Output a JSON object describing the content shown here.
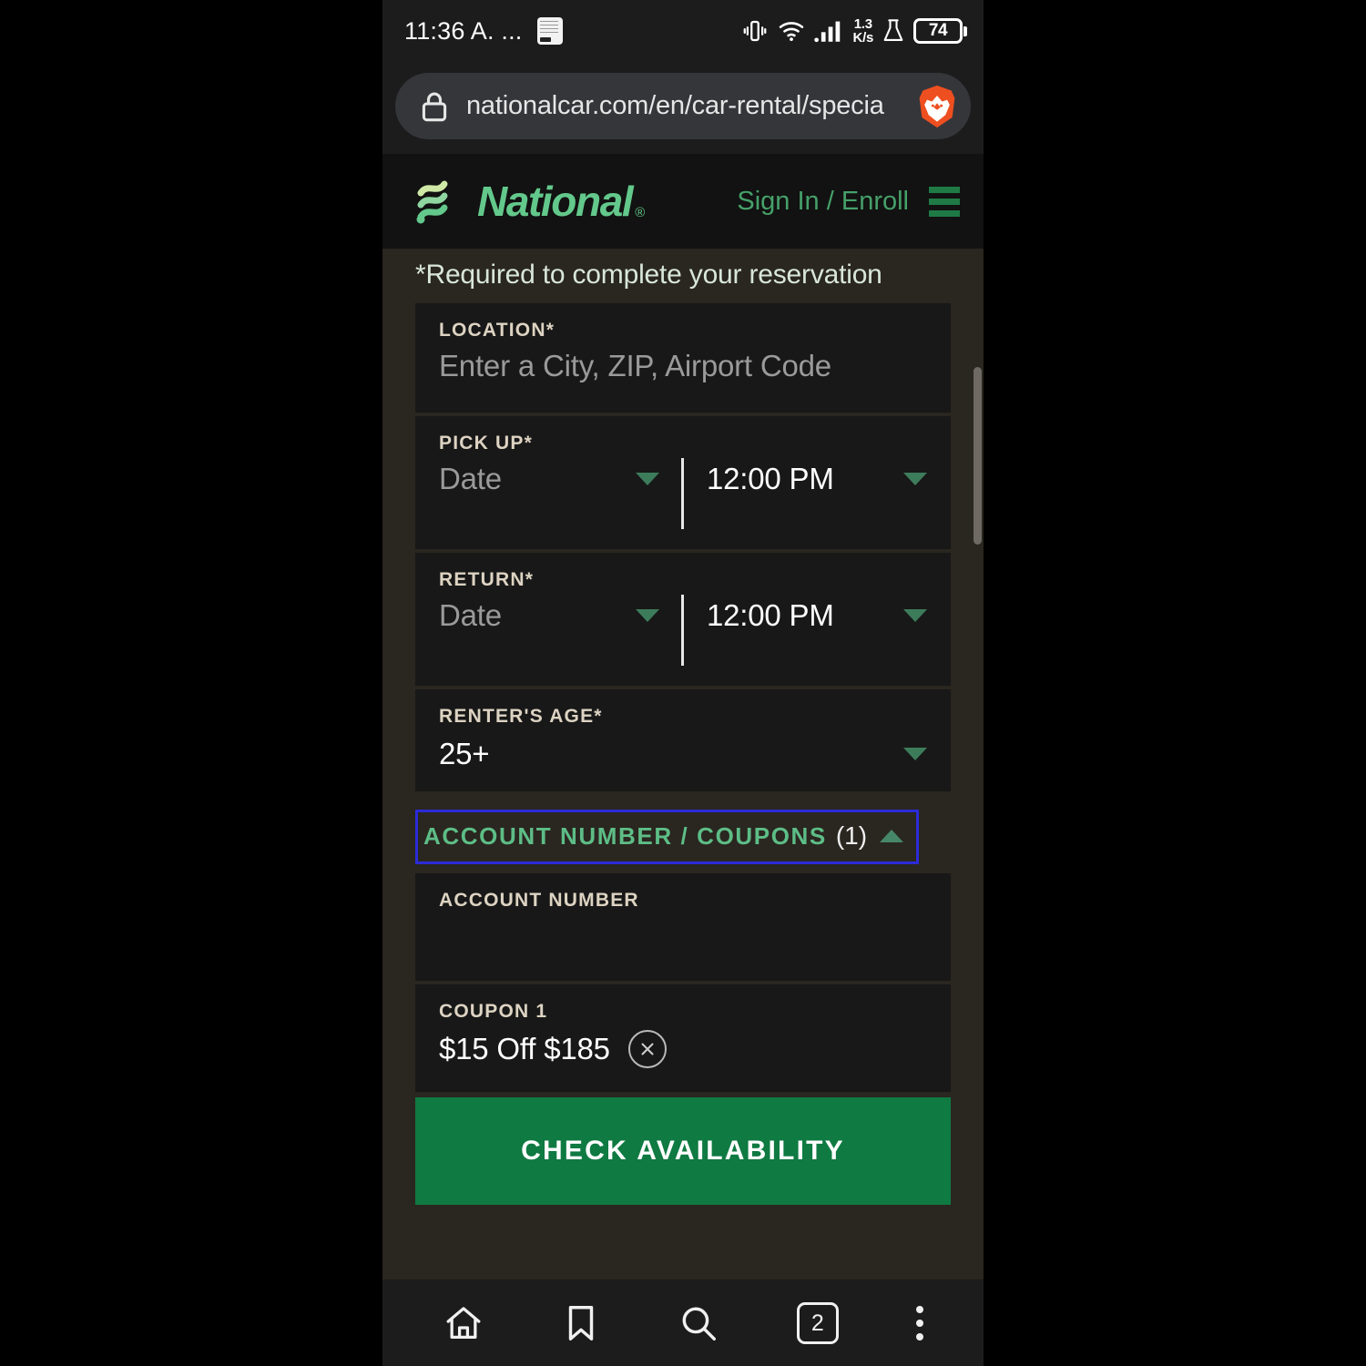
{
  "status_bar": {
    "time": "11:36 A. ...",
    "app_icon": "book-icon",
    "vibrate_icon": "vibrate-icon",
    "wifi_icon": "wifi-icon",
    "signal_icon": "signal-bars-icon",
    "network_speed_value": "1.3",
    "network_speed_unit": "K/s",
    "flask_icon": "flask-icon",
    "battery_level": "74"
  },
  "browser": {
    "url": "nationalcar.com/en/car-rental/specia",
    "lock_icon": "lock-icon",
    "brand_icon": "brave-lion-icon",
    "bottom_nav": {
      "home": "home-icon",
      "bookmarks": "bookmark-icon",
      "search": "search-icon",
      "tab_count": "2",
      "menu": "kebab-menu-icon"
    }
  },
  "site_header": {
    "brand": "National",
    "brand_registered": "®",
    "brand_mark_icon": "national-waves-logo-icon",
    "sign_in_label": "Sign In / Enroll",
    "menu_icon": "hamburger-menu-icon",
    "brand_color": "#63c88b"
  },
  "reservation_form": {
    "required_note": "*Required to complete your reservation",
    "location": {
      "label": "LOCATION*",
      "placeholder": "Enter a City, ZIP, Airport Code",
      "value": ""
    },
    "pick_up": {
      "label": "PICK UP*",
      "date_placeholder": "Date",
      "time_value": "12:00 PM",
      "date_caret_icon": "chevron-down-icon",
      "time_caret_icon": "chevron-down-icon"
    },
    "return": {
      "label": "RETURN*",
      "date_placeholder": "Date",
      "time_value": "12:00 PM",
      "date_caret_icon": "chevron-down-icon",
      "time_caret_icon": "chevron-down-icon"
    },
    "renters_age": {
      "label": "RENTER'S AGE*",
      "value": "25+",
      "caret_icon": "chevron-down-icon"
    },
    "accordion": {
      "label": "ACCOUNT NUMBER / COUPONS",
      "count": "(1)",
      "caret_icon": "chevron-up-icon",
      "focus_outline_color": "#2b2bd8"
    },
    "account_number": {
      "label": "ACCOUNT NUMBER",
      "value": ""
    },
    "coupon_1": {
      "label": "COUPON 1",
      "value": "$15 Off $185",
      "remove_icon": "close-circle-icon"
    },
    "submit_label": "CHECK AVAILABILITY",
    "submit_color": "#0f7a42"
  }
}
